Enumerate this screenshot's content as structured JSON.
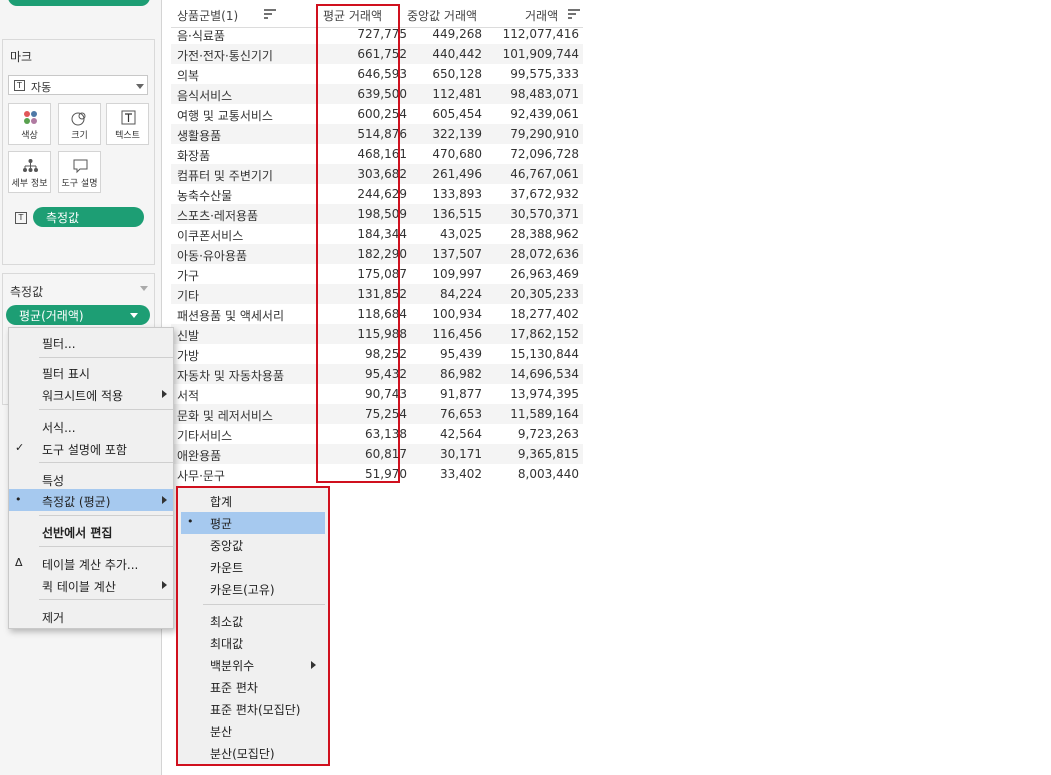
{
  "marks_card": {
    "title": "마크",
    "mark_type": "자동",
    "buttons": [
      {
        "label": "색상",
        "icon": "color-dots-icon"
      },
      {
        "label": "크기",
        "icon": "size-icon"
      },
      {
        "label": "텍스트",
        "icon": "text-icon"
      },
      {
        "label": "세부 정보",
        "icon": "detail-icon"
      },
      {
        "label": "도구 설명",
        "icon": "tooltip-icon"
      }
    ],
    "measure_pill": "측정값"
  },
  "measures_card": {
    "title": "측정값",
    "pill": "평균(거래액)"
  },
  "table": {
    "headers": {
      "category": "상품군별(1)",
      "avg": "평균 거래액",
      "median": "중앙값 거래액",
      "sum": "거래액"
    },
    "rows": [
      {
        "name": "음·식료품",
        "avg": "727,775",
        "median": "449,268",
        "sum": "112,077,416"
      },
      {
        "name": "가전·전자·통신기기",
        "avg": "661,752",
        "median": "440,442",
        "sum": "101,909,744"
      },
      {
        "name": "의복",
        "avg": "646,593",
        "median": "650,128",
        "sum": "99,575,333"
      },
      {
        "name": "음식서비스",
        "avg": "639,500",
        "median": "112,481",
        "sum": "98,483,071"
      },
      {
        "name": "여행 및 교통서비스",
        "avg": "600,254",
        "median": "605,454",
        "sum": "92,439,061"
      },
      {
        "name": "생활용품",
        "avg": "514,876",
        "median": "322,139",
        "sum": "79,290,910"
      },
      {
        "name": "화장품",
        "avg": "468,161",
        "median": "470,680",
        "sum": "72,096,728"
      },
      {
        "name": "컴퓨터 및 주변기기",
        "avg": "303,682",
        "median": "261,496",
        "sum": "46,767,061"
      },
      {
        "name": "농축수산물",
        "avg": "244,629",
        "median": "133,893",
        "sum": "37,672,932"
      },
      {
        "name": "스포츠·레저용품",
        "avg": "198,509",
        "median": "136,515",
        "sum": "30,570,371"
      },
      {
        "name": "이쿠폰서비스",
        "avg": "184,344",
        "median": "43,025",
        "sum": "28,388,962"
      },
      {
        "name": "아동·유아용품",
        "avg": "182,290",
        "median": "137,507",
        "sum": "28,072,636"
      },
      {
        "name": "가구",
        "avg": "175,087",
        "median": "109,997",
        "sum": "26,963,469"
      },
      {
        "name": "기타",
        "avg": "131,852",
        "median": "84,224",
        "sum": "20,305,233"
      },
      {
        "name": "패션용품 및 액세서리",
        "avg": "118,684",
        "median": "100,934",
        "sum": "18,277,402"
      },
      {
        "name": "신발",
        "avg": "115,988",
        "median": "116,456",
        "sum": "17,862,152"
      },
      {
        "name": "가방",
        "avg": "98,252",
        "median": "95,439",
        "sum": "15,130,844"
      },
      {
        "name": "자동차 및 자동차용품",
        "avg": "95,432",
        "median": "86,982",
        "sum": "14,696,534"
      },
      {
        "name": "서적",
        "avg": "90,743",
        "median": "91,877",
        "sum": "13,974,395"
      },
      {
        "name": "문화 및 레저서비스",
        "avg": "75,254",
        "median": "76,653",
        "sum": "11,589,164"
      },
      {
        "name": "기타서비스",
        "avg": "63,138",
        "median": "42,564",
        "sum": "9,723,263"
      },
      {
        "name": "애완용품",
        "avg": "60,817",
        "median": "30,171",
        "sum": "9,365,815"
      },
      {
        "name": "사무·문구",
        "avg": "51,970",
        "median": "33,402",
        "sum": "8,003,440"
      }
    ]
  },
  "context_menu": {
    "items": [
      {
        "label": "필터..."
      },
      {
        "label": "필터 표시"
      },
      {
        "label": "워크시트에 적용",
        "submenu": true
      },
      {
        "label": "서식..."
      },
      {
        "label": "도구 설명에 포함",
        "mark": "✓"
      },
      {
        "label": "특성"
      },
      {
        "label": "측정값 (평균)",
        "submenu": true,
        "mark": "•",
        "highlighted": true
      },
      {
        "label": "선반에서 편집",
        "bold": true
      },
      {
        "label": "테이블 계산 추가...",
        "mark": "Δ"
      },
      {
        "label": "퀵 테이블 계산",
        "submenu": true
      },
      {
        "label": "제거"
      }
    ]
  },
  "aggregation_submenu": {
    "items": [
      {
        "label": "합계"
      },
      {
        "label": "평균",
        "mark": "•",
        "highlighted": true
      },
      {
        "label": "중앙값"
      },
      {
        "label": "카운트"
      },
      {
        "label": "카운트(고유)"
      },
      {
        "label": "최소값"
      },
      {
        "label": "최대값"
      },
      {
        "label": "백분위수",
        "submenu": true
      },
      {
        "label": "표준 편차"
      },
      {
        "label": "표준 편차(모집단)"
      },
      {
        "label": "분산"
      },
      {
        "label": "분산(모집단)"
      }
    ]
  },
  "colors": {
    "pill_green": "#1d9e74",
    "highlight_blue": "#a6c9ef",
    "annotation_red": "#d0101e"
  }
}
